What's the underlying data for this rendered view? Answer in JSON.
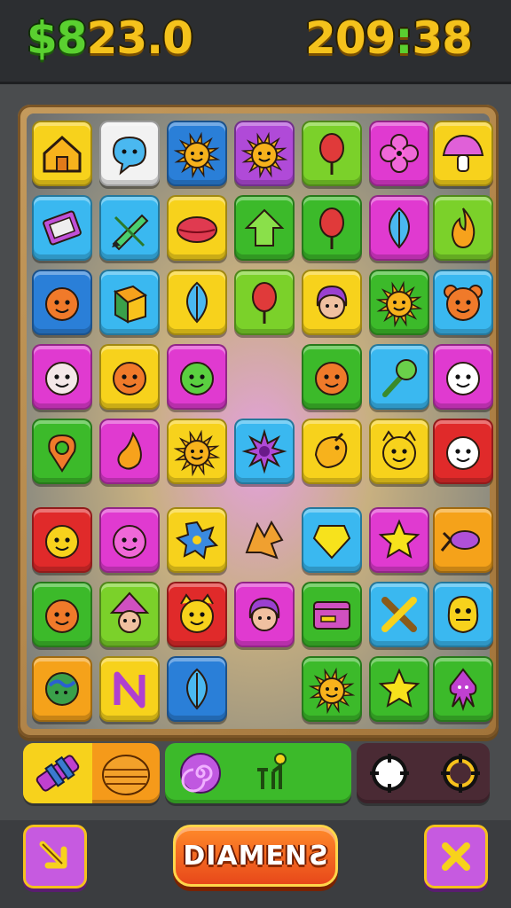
{
  "hud": {
    "score_green": "$8",
    "score_rest": "23.0",
    "timer": "209",
    "timer_sep": ":",
    "timer_end": "38"
  },
  "board": {
    "colors": {
      "orange": "#f5a21a",
      "white": "#f2f2f2",
      "blue": "#2a7fd8",
      "purple": "#b04ad8",
      "lime": "#7bd12a",
      "magenta": "#e03ad0",
      "yellow": "#f7d21c",
      "cyan": "#3ab8f0",
      "green": "#3cba2a",
      "red": "#e02a2a"
    },
    "rows": [
      [
        "yellow:house-icon",
        "white:speech-bubble-icon",
        "blue:sun-icon",
        "purple:sun-icon",
        "lime:balloon-icon",
        "magenta:flower-icon",
        "yellow:mushroom-icon"
      ],
      [
        "cyan:card-icon",
        "cyan:pencil-icon",
        "yellow:lips-icon",
        "green:arrow-up-icon",
        "green:balloon-icon",
        "magenta:leaf-icon",
        "lime:flame-icon"
      ],
      [
        "blue:pumpkin-face-icon",
        "cyan:box-icon",
        "yellow:leaf-icon",
        "lime:balloon-icon",
        "yellow:girl-face-icon",
        "green:sun-icon",
        "cyan:bear-face-icon"
      ],
      [
        "magenta:mask-face-icon",
        "yellow:orange-face-icon",
        "magenta:green-blob-face-icon",
        "empty",
        "green:flame-face-icon",
        "cyan:lollipop-icon",
        "magenta:ghost-face-icon"
      ],
      [
        "green:map-pin-icon",
        "magenta:drop-icon",
        "yellow:sun-face-icon",
        "cyan:purple-star-icon",
        "yellow:bird-icon",
        "yellow:cat-face-icon",
        "red:ghost-face-icon"
      ],
      [
        "red:smiley-icon",
        "magenta:pink-face-icon",
        "yellow:blue-splat-icon",
        "empty:leaf-gold-icon",
        "cyan:gem-icon",
        "magenta:star-icon",
        "orange:fish-icon"
      ],
      [
        "green:flame-face-icon",
        "lime:witch-face-icon",
        "red:cat-face-icon",
        "magenta:girl-face-icon",
        "green:wallet-icon",
        "cyan:cross-icon",
        "cyan:monster-icon"
      ],
      [
        "orange:earth-icon",
        "yellow:letter-n-icon",
        "blue:leaf-icon",
        "empty",
        "green:sun-face-icon",
        "green:star-icon",
        "green:squid-icon"
      ]
    ]
  },
  "powerups": [
    {
      "name": "bomb-powerup",
      "bg": "#f7d21c"
    },
    {
      "name": "burger-powerup",
      "bg": "#f59a1a"
    },
    {
      "name": "swirl-powerup",
      "bg": "#3cba2a"
    },
    {
      "name": "monkey-powerup",
      "bg": "#3cba2a"
    },
    {
      "name": "target-powerup",
      "bg": "#4a2a34"
    },
    {
      "name": "crosshair-powerup",
      "bg": "#4a2a34"
    }
  ],
  "controls": {
    "left_icon": "arrow-down-right-icon",
    "main_button_label": "DIAMEN",
    "main_button_label_end": "S",
    "right_icon": "close-icon"
  }
}
